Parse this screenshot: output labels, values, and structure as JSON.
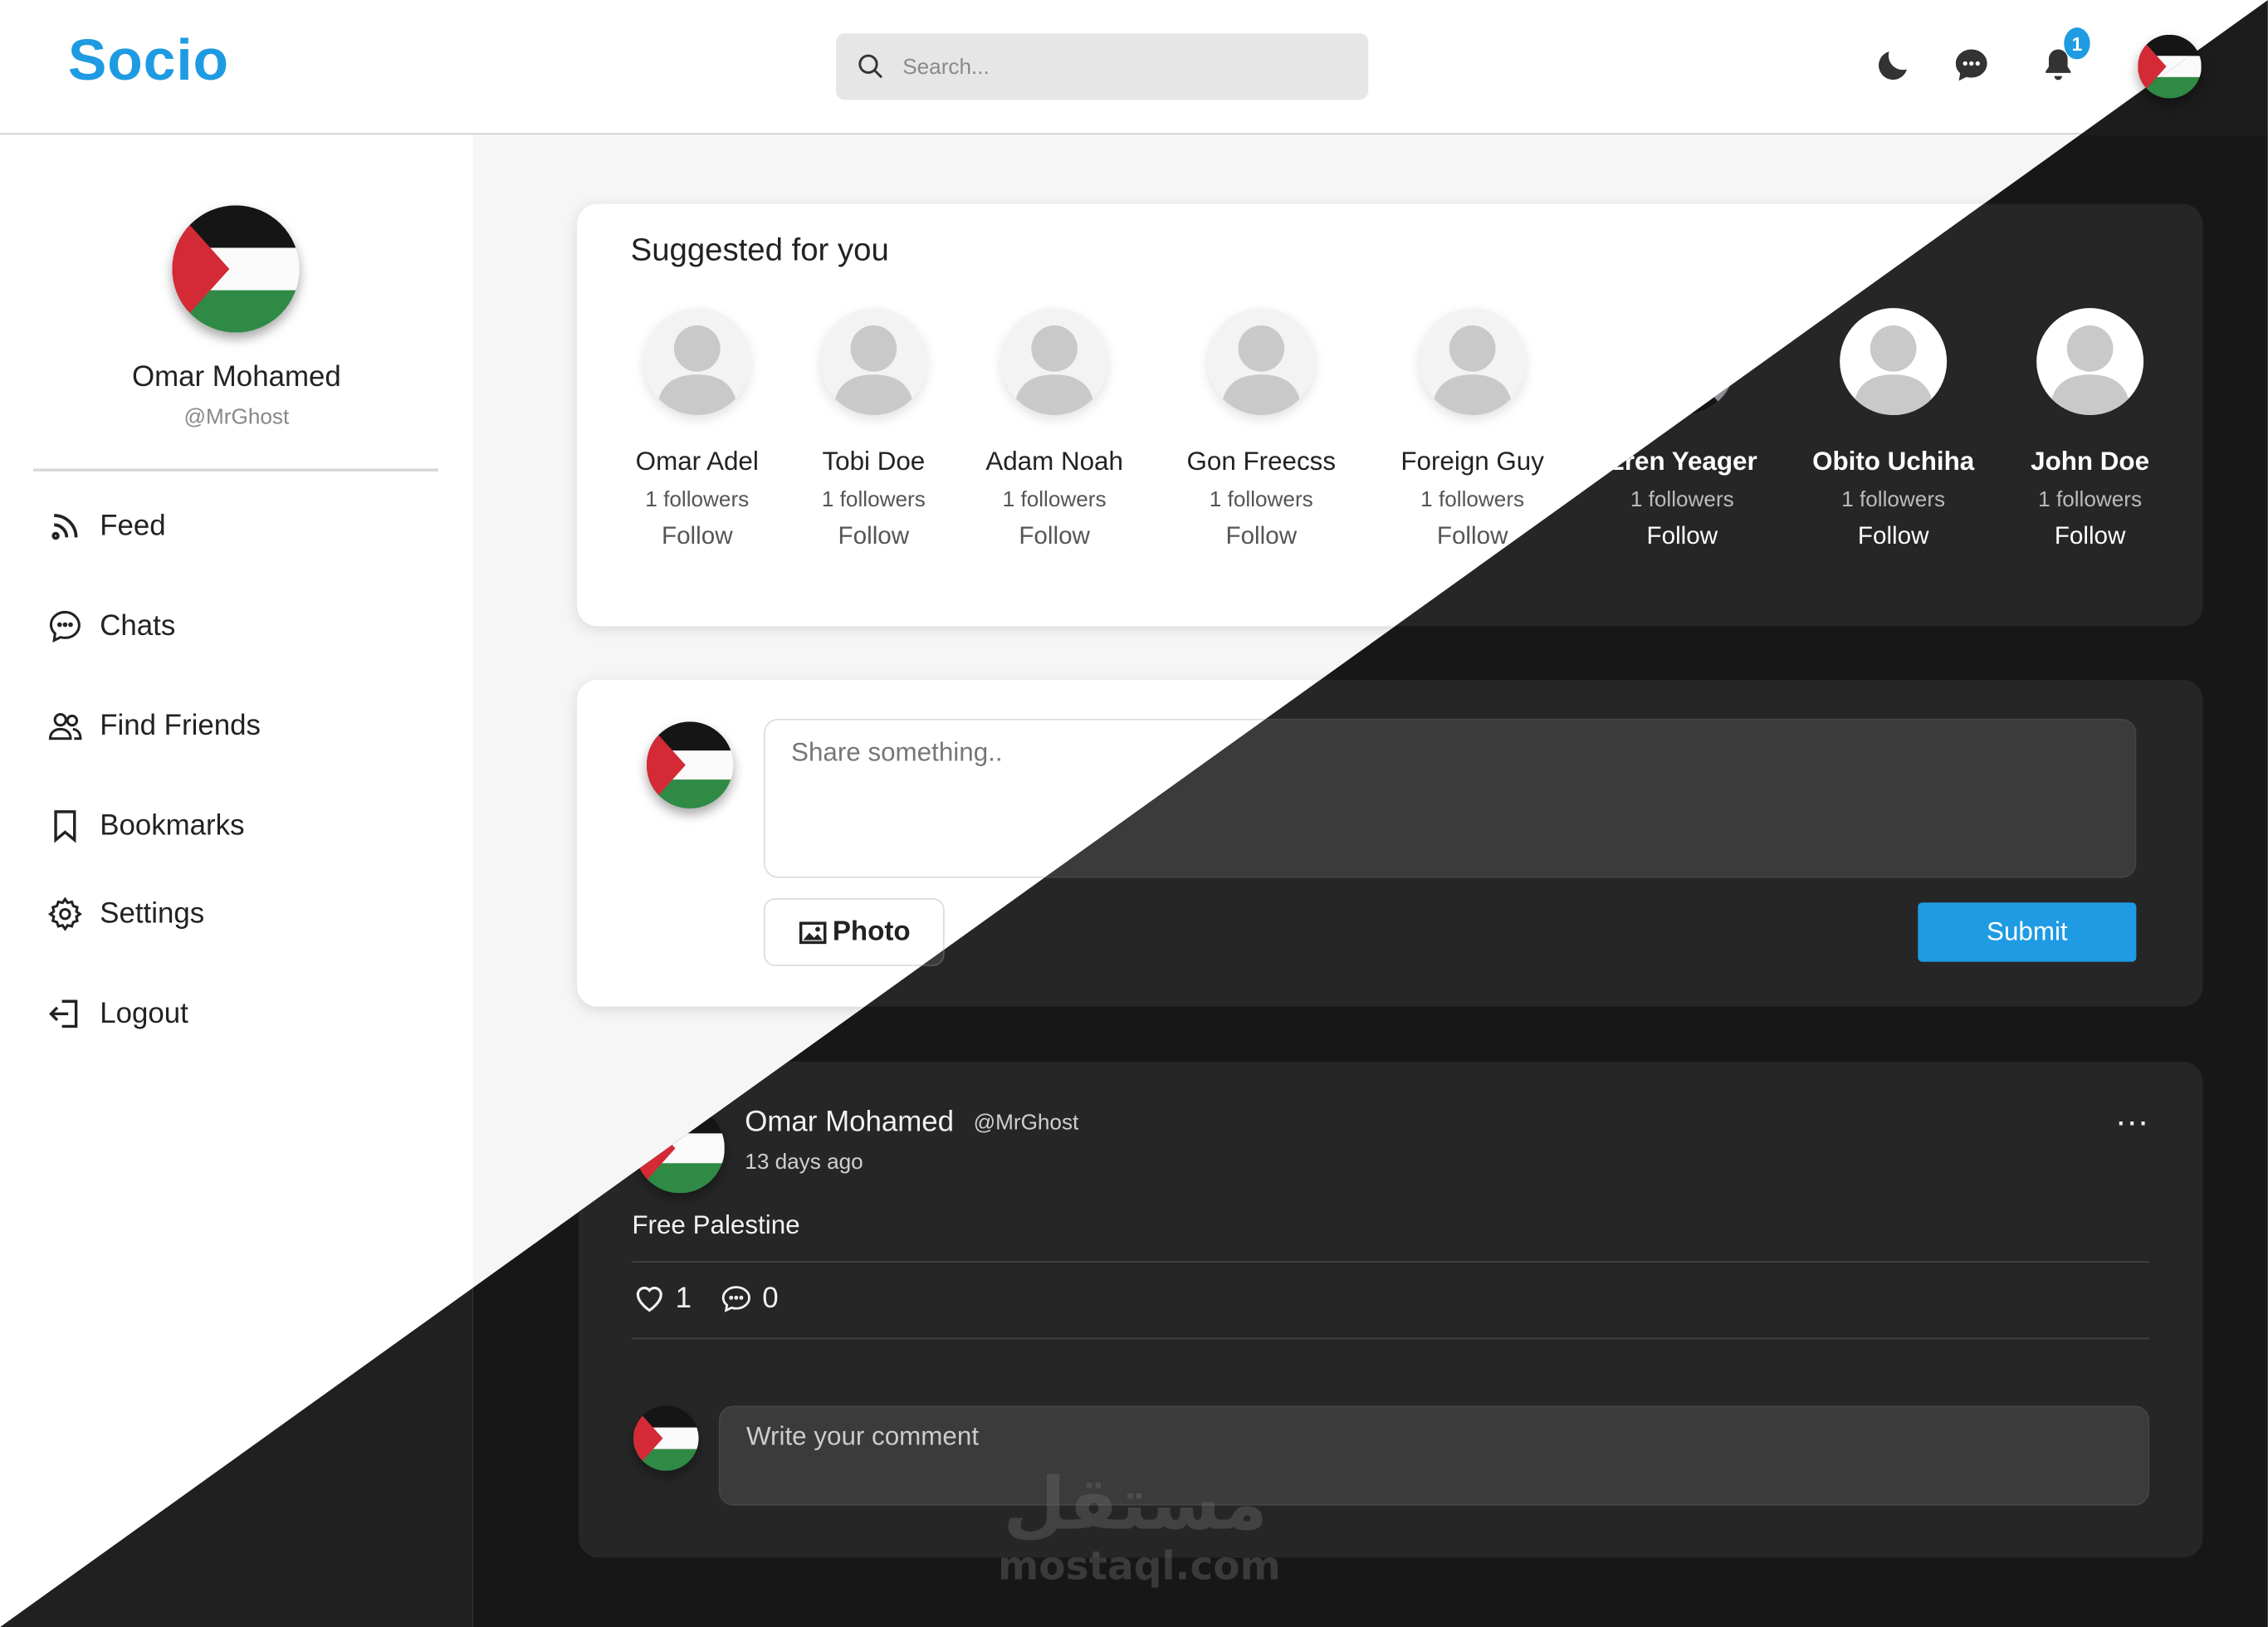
{
  "header": {
    "logo": "Socio",
    "search_placeholder": "Search...",
    "notification_count": "1",
    "icons": [
      "moon-icon",
      "chat-bubble-icon",
      "bell-icon"
    ]
  },
  "profile": {
    "name": "Omar Mohamed",
    "handle": "@MrGhost"
  },
  "nav": [
    {
      "label": "Feed",
      "icon": "rss-icon"
    },
    {
      "label": "Chats",
      "icon": "chat-icon"
    },
    {
      "label": "Find Friends",
      "icon": "users-icon"
    },
    {
      "label": "Bookmarks",
      "icon": "bookmark-icon"
    },
    {
      "label": "Settings",
      "icon": "gear-icon"
    },
    {
      "label": "Logout",
      "icon": "logout-icon"
    }
  ],
  "suggestions": {
    "title": "Suggested for you",
    "items": [
      {
        "name": "Omar Adel",
        "followers": "1 followers",
        "action": "Follow"
      },
      {
        "name": "Tobi Doe",
        "followers": "1 followers",
        "action": "Follow"
      },
      {
        "name": "Adam Noah",
        "followers": "1 followers",
        "action": "Follow"
      },
      {
        "name": "Gon Freecss",
        "followers": "1 followers",
        "action": "Follow"
      },
      {
        "name": "Foreign Guy",
        "followers": "1 followers",
        "action": "Follow"
      },
      {
        "name": "Eren Yeager",
        "followers": "1 followers",
        "action": "Follow"
      },
      {
        "name": "Obito Uchiha",
        "followers": "1 followers",
        "action": "Follow"
      },
      {
        "name": "John Doe",
        "followers": "1 followers",
        "action": "Follow"
      }
    ]
  },
  "share": {
    "placeholder": "Share something..",
    "photo_label": "Photo",
    "submit_label": "Submit"
  },
  "post": {
    "author": "Omar Mohamed",
    "handle": "@MrGhost",
    "time": "13 days ago",
    "text": "Free Palestine",
    "likes": "1",
    "comments": "0",
    "more": "...",
    "comment_placeholder": "Write your comment"
  },
  "watermark": {
    "arabic": "مستقل",
    "latin": "mostaql.com"
  },
  "colors": {
    "accent": "#1e9be2",
    "light_bg": "#f6f6f6",
    "dark_bg": "#171717",
    "dark_card": "#262626"
  }
}
